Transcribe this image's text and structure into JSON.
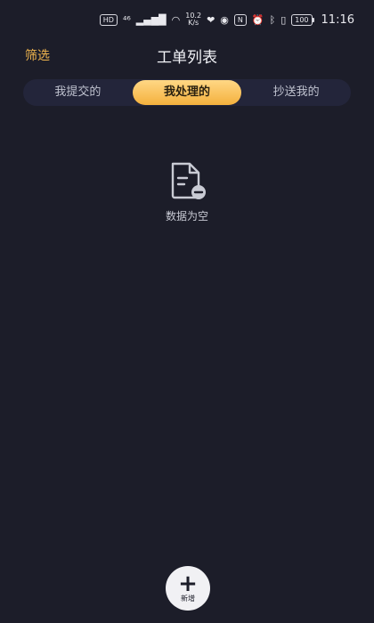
{
  "status_bar": {
    "hd_chip": "HD",
    "network": "⁴⁶",
    "speed_value": "10.2",
    "speed_unit": "K/s",
    "nfc": "N",
    "battery": "100",
    "time": "11:16"
  },
  "header": {
    "filter_label": "筛选",
    "title": "工单列表"
  },
  "tabs": [
    {
      "label": "我提交的",
      "active": false
    },
    {
      "label": "我处理的",
      "active": true
    },
    {
      "label": "抄送我的",
      "active": false
    }
  ],
  "empty_state": {
    "message": "数据为空",
    "icon": "document-minus-icon"
  },
  "fab": {
    "symbol": "+",
    "label": "新增"
  },
  "colors": {
    "background": "#1c1d29",
    "accent": "#f0b54e",
    "tab_active_top": "#ffd785",
    "tab_active_bottom": "#f4b13d"
  }
}
